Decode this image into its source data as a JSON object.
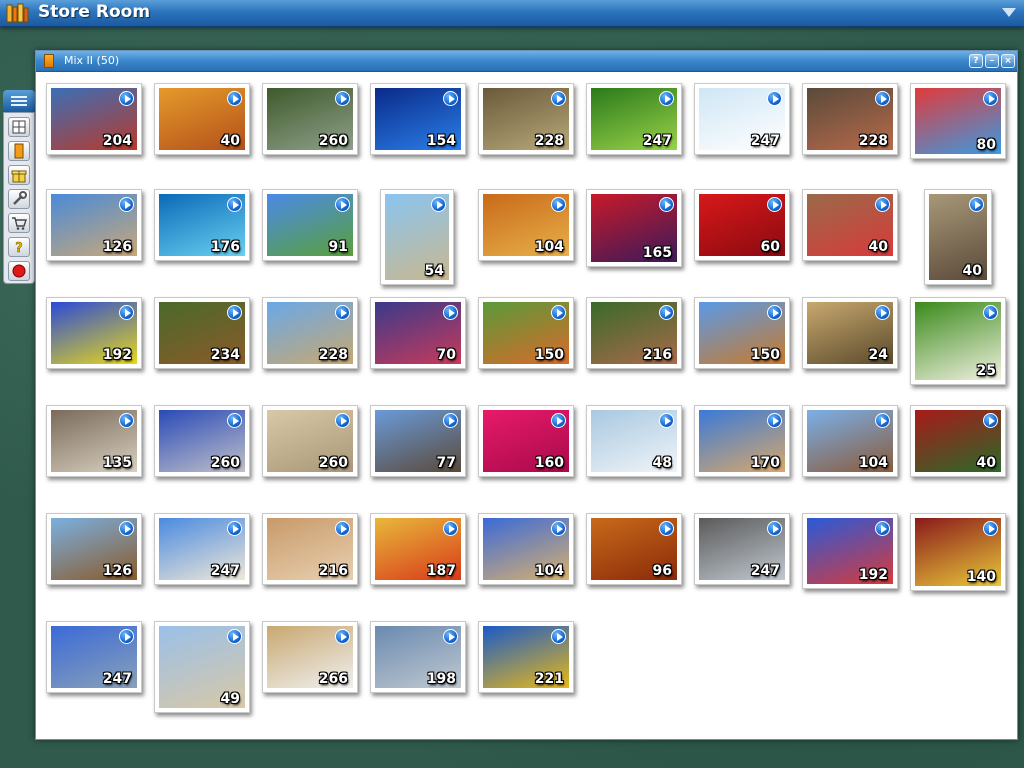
{
  "app": {
    "title": "Store Room",
    "menu_icon": "chevron-down-icon"
  },
  "sidebar": {
    "tab_icon": "menu-lines-icon",
    "buttons": [
      {
        "name": "puzzle-grid-icon"
      },
      {
        "name": "book-icon"
      },
      {
        "name": "gift-icon"
      },
      {
        "name": "wrench-icon"
      },
      {
        "name": "cart-icon"
      },
      {
        "name": "help-icon"
      },
      {
        "name": "exit-icon"
      }
    ]
  },
  "panel": {
    "title": "Mix II (50)",
    "buttons": {
      "help": "?",
      "minimize": "–",
      "close": "×"
    }
  },
  "colors": {
    "titlebar": "#2c74bd",
    "play_icon": "#0b5cc7",
    "background": "#2f5a4c",
    "panel_background": "#ffffff"
  },
  "puzzles": [
    {
      "subject": "truck",
      "count": "204",
      "c1": "#3a6fb8",
      "c2": "#b83a2a"
    },
    {
      "subject": "autumn-leaves",
      "count": "40",
      "c1": "#e59a2b",
      "c2": "#b3501a"
    },
    {
      "subject": "forest-stream",
      "count": "260",
      "c1": "#3f5a2c",
      "c2": "#8fa08a"
    },
    {
      "subject": "blue-car",
      "count": "154",
      "c1": "#0a2a8a",
      "c2": "#2a7fe8"
    },
    {
      "subject": "bear",
      "count": "228",
      "c1": "#6a5a3a",
      "c2": "#b8a87a"
    },
    {
      "subject": "caterpillar",
      "count": "247",
      "c1": "#2a7a1a",
      "c2": "#9ad24a"
    },
    {
      "subject": "white-blossoms",
      "count": "247",
      "c1": "#cfe6f5",
      "c2": "#ffffff"
    },
    {
      "subject": "canal-houses",
      "count": "228",
      "c1": "#5a4a3a",
      "c2": "#b86a4a"
    },
    {
      "subject": "colored-pencils",
      "count": "80",
      "c1": "#e23a3a",
      "c2": "#3a9ae2"
    },
    {
      "subject": "colosseum",
      "count": "126",
      "c1": "#4a8ad8",
      "c2": "#c8a878"
    },
    {
      "subject": "dolphin",
      "count": "176",
      "c1": "#0a6ab8",
      "c2": "#6ad0f0"
    },
    {
      "subject": "windmill",
      "count": "91",
      "c1": "#4a8ae8",
      "c2": "#5aa03a"
    },
    {
      "subject": "eiffel-tower",
      "count": "54",
      "c1": "#8ac4f0",
      "c2": "#c8b890"
    },
    {
      "subject": "autumn-path",
      "count": "104",
      "c1": "#c86a1a",
      "c2": "#e8b04a"
    },
    {
      "subject": "berries",
      "count": "165",
      "c1": "#c81a2a",
      "c2": "#3a1a5a"
    },
    {
      "subject": "strawberries",
      "count": "60",
      "c1": "#d8181a",
      "c2": "#8a0a10"
    },
    {
      "subject": "flower-window",
      "count": "40",
      "c1": "#9a6a4a",
      "c2": "#d83a3a"
    },
    {
      "subject": "giraffe",
      "count": "40",
      "c1": "#a89878",
      "c2": "#5a4a3a"
    },
    {
      "subject": "graffiti",
      "count": "192",
      "c1": "#2a4ad8",
      "c2": "#e8d81a"
    },
    {
      "subject": "horses",
      "count": "234",
      "c1": "#4a6a2a",
      "c2": "#8a5a2a"
    },
    {
      "subject": "parliament",
      "count": "228",
      "c1": "#6aa8e8",
      "c2": "#c8a870"
    },
    {
      "subject": "airplane",
      "count": "70",
      "c1": "#3a3a8a",
      "c2": "#c83a5a"
    },
    {
      "subject": "horse-race",
      "count": "150",
      "c1": "#5a9a3a",
      "c2": "#d86a2a"
    },
    {
      "subject": "village",
      "count": "216",
      "c1": "#3a6a2a",
      "c2": "#a86a4a"
    },
    {
      "subject": "pagoda",
      "count": "150",
      "c1": "#5a9ae8",
      "c2": "#c87a2a"
    },
    {
      "subject": "leopard",
      "count": "24",
      "c1": "#c8a870",
      "c2": "#5a4a2a"
    },
    {
      "subject": "daisies",
      "count": "25",
      "c1": "#3a8a1a",
      "c2": "#f0f0e0"
    },
    {
      "subject": "cliff-dwellings",
      "count": "135",
      "c1": "#7a6a5a",
      "c2": "#d8d0c0"
    },
    {
      "subject": "motorcycles",
      "count": "260",
      "c1": "#2a4ab8",
      "c2": "#c0c0c8"
    },
    {
      "subject": "atrium",
      "count": "260",
      "c1": "#d8c8a8",
      "c2": "#a89878"
    },
    {
      "subject": "manor-house",
      "count": "77",
      "c1": "#6a9ad8",
      "c2": "#5a4a3a"
    },
    {
      "subject": "pink-orchids",
      "count": "160",
      "c1": "#e81a6a",
      "c2": "#a80a4a"
    },
    {
      "subject": "polar-bear",
      "count": "48",
      "c1": "#a8c8e0",
      "c2": "#f0f4f8"
    },
    {
      "subject": "ponte-vecchio",
      "count": "170",
      "c1": "#3a7ad8",
      "c2": "#d8a86a"
    },
    {
      "subject": "quad-bike",
      "count": "104",
      "c1": "#7ab0e8",
      "c2": "#8a5a3a"
    },
    {
      "subject": "roulette",
      "count": "40",
      "c1": "#a81a1a",
      "c2": "#2a6a2a"
    },
    {
      "subject": "ship",
      "count": "126",
      "c1": "#7ab0e0",
      "c2": "#8a5a2a"
    },
    {
      "subject": "santorini",
      "count": "247",
      "c1": "#4a8ae0",
      "c2": "#f0e8d8"
    },
    {
      "subject": "seashells",
      "count": "216",
      "c1": "#c89a6a",
      "c2": "#e8d0b0"
    },
    {
      "subject": "pasta",
      "count": "187",
      "c1": "#e8b83a",
      "c2": "#d83a1a"
    },
    {
      "subject": "sphinx",
      "count": "104",
      "c1": "#3a6ad8",
      "c2": "#d8b070"
    },
    {
      "subject": "spices",
      "count": "96",
      "c1": "#c86a1a",
      "c2": "#8a2a0a"
    },
    {
      "subject": "steam-train",
      "count": "247",
      "c1": "#5a5a5a",
      "c2": "#c0c8d0"
    },
    {
      "subject": "prayer-flags",
      "count": "192",
      "c1": "#2a5ad8",
      "c2": "#d83a3a"
    },
    {
      "subject": "football",
      "count": "140",
      "c1": "#8a1a1a",
      "c2": "#e8c83a"
    },
    {
      "subject": "tower-bridge",
      "count": "247",
      "c1": "#3a6ad8",
      "c2": "#8aa0b8"
    },
    {
      "subject": "trevi-fountain",
      "count": "49",
      "c1": "#9ac0e8",
      "c2": "#d8c8a8"
    },
    {
      "subject": "lions",
      "count": "266",
      "c1": "#c8a870",
      "c2": "#f0f0f0"
    },
    {
      "subject": "city-skyline",
      "count": "198",
      "c1": "#6a8ab0",
      "c2": "#c0c8d0"
    },
    {
      "subject": "autumn-canopy",
      "count": "221",
      "c1": "#1a5ac8",
      "c2": "#e8b81a"
    }
  ]
}
